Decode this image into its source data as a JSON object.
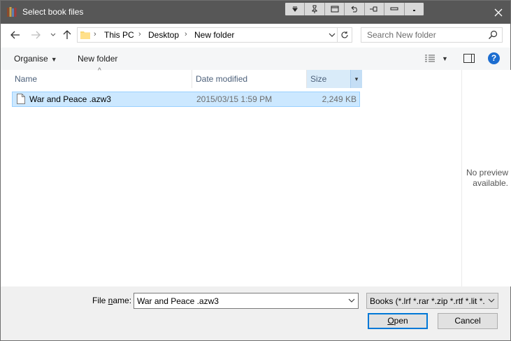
{
  "window": {
    "title": "Select book files",
    "close_icon": "close-icon"
  },
  "mini_toolbar": {
    "icons": [
      "dropdown-icon",
      "pin-icon",
      "restore-icon",
      "undo-icon",
      "connector-icon",
      "minimize-icon",
      "close-small-icon"
    ]
  },
  "nav": {
    "back_icon": "arrow-left-icon",
    "forward_icon": "arrow-right-icon",
    "recent_icon": "chevron-down-icon",
    "up_icon": "arrow-up-icon",
    "breadcrumb": [
      "This PC",
      "Desktop",
      "New folder"
    ],
    "search_placeholder": "Search New folder"
  },
  "commands": {
    "organise_label": "Organise",
    "new_folder_label": "New folder"
  },
  "columns": {
    "name": "Name",
    "date_modified": "Date modified",
    "size": "Size"
  },
  "files": [
    {
      "name": "War and Peace .azw3",
      "date": "2015/03/15 1:59 PM",
      "size": "2,249 KB",
      "selected": true
    }
  ],
  "preview": {
    "line1": "No preview",
    "line2": "available."
  },
  "bottom": {
    "file_name_label_pre": "File ",
    "file_name_label_underlined": "n",
    "file_name_label_post": "ame:",
    "file_name_value": "War and Peace .azw3",
    "file_type_value": "Books (*.lrf *.rar *.zip *.rtf *.lit *.",
    "open_label_underlined": "O",
    "open_label_rest": "pen",
    "cancel_label": "Cancel"
  },
  "colors": {
    "titlebar": "#575757",
    "selection": "#cce8ff",
    "accent": "#0078d7",
    "help": "#1c6dd0"
  }
}
